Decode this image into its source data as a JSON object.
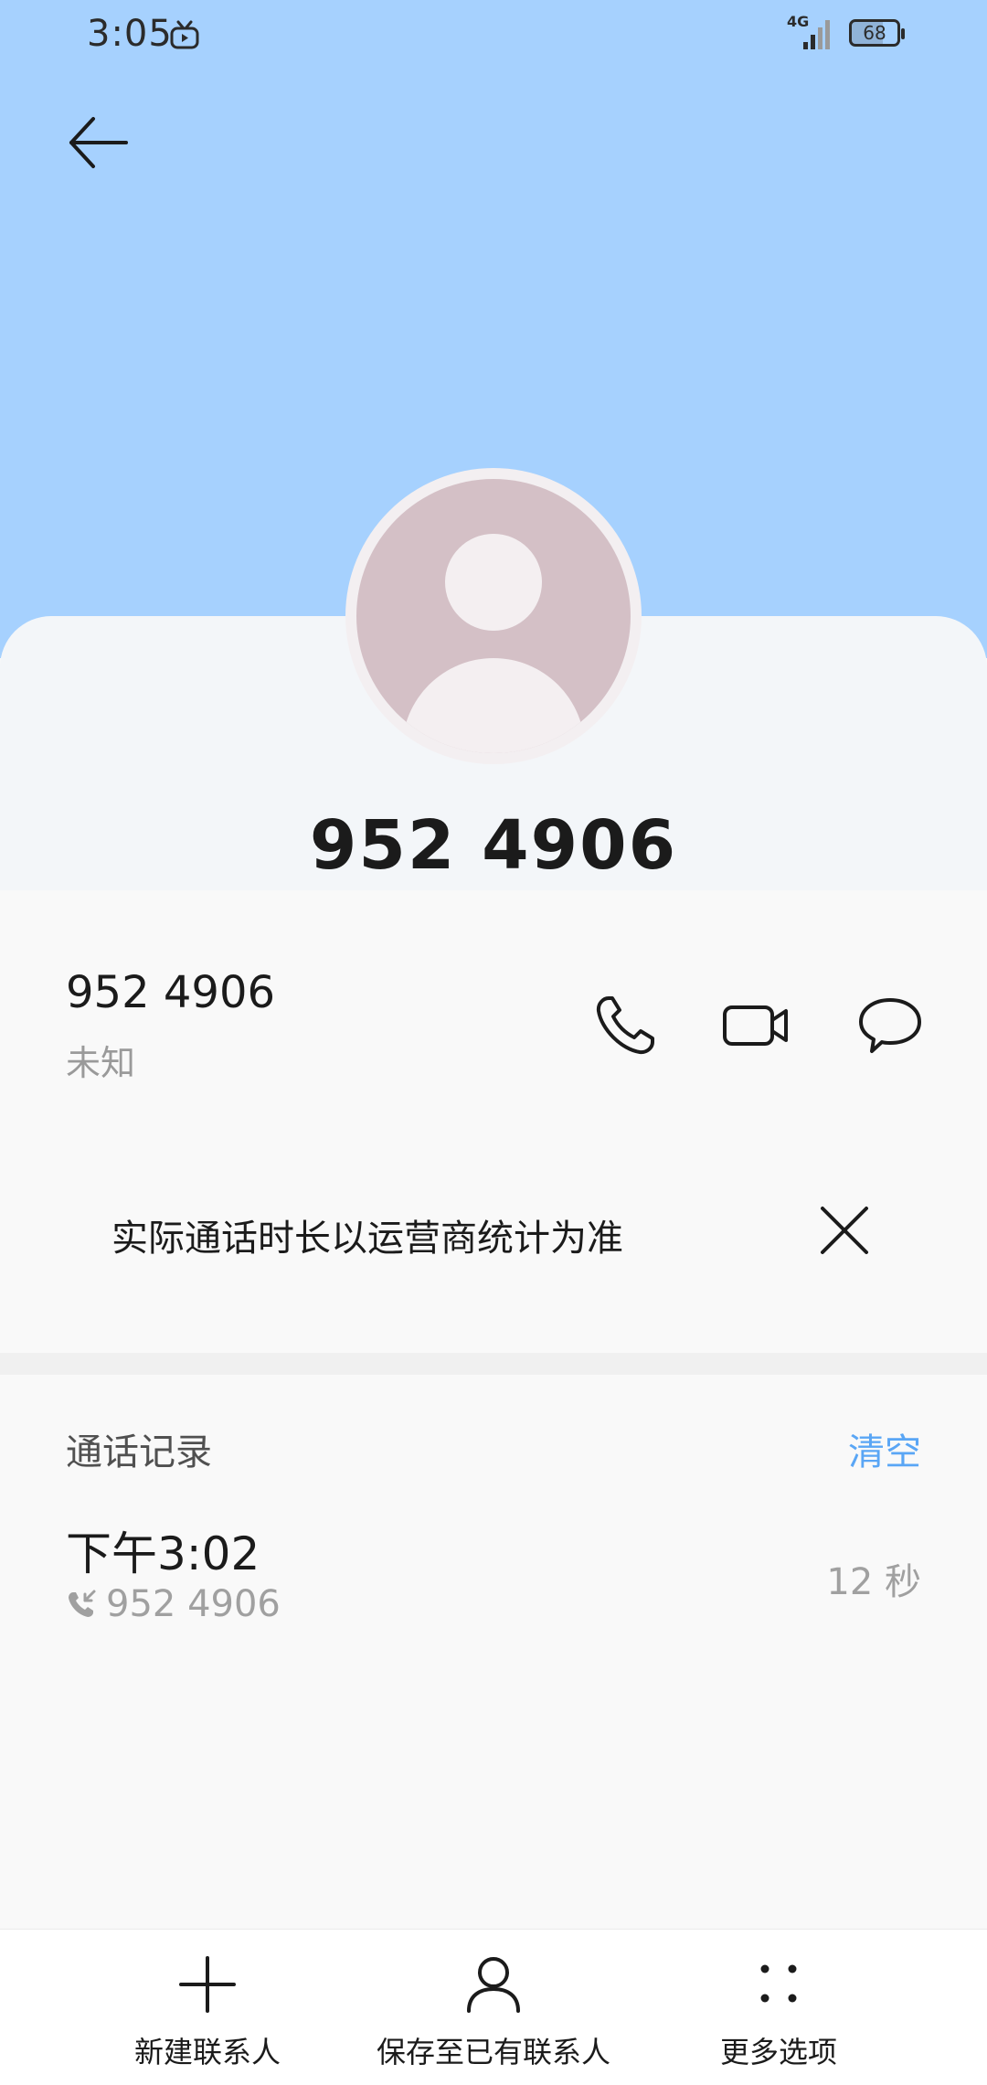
{
  "status_bar": {
    "time": "3:05",
    "network_type": "4G",
    "battery_level": "68",
    "icons": [
      "tv-icon",
      "signal-icon",
      "battery-icon"
    ]
  },
  "header": {
    "back_icon": "back-arrow-icon",
    "title": "952 4906"
  },
  "avatar": {
    "icon": "default-avatar-icon"
  },
  "number_row": {
    "number": "952 4906",
    "label": "未知",
    "actions": [
      {
        "name": "call",
        "icon": "phone-icon"
      },
      {
        "name": "video",
        "icon": "video-camera-icon"
      },
      {
        "name": "message",
        "icon": "message-icon"
      }
    ]
  },
  "notice": {
    "text": "实际通话时长以运营商统计为准",
    "close_icon": "close-icon"
  },
  "call_log": {
    "title": "通话记录",
    "clear_label": "清空",
    "entries": [
      {
        "time": "下午3:02",
        "number": "952 4906",
        "duration": "12 秒",
        "icon": "incoming-call-icon"
      }
    ]
  },
  "bottom_bar": {
    "items": [
      {
        "label": "新建联系人",
        "icon": "plus-icon"
      },
      {
        "label": "保存至已有联系人",
        "icon": "person-icon"
      },
      {
        "label": "更多选项",
        "icon": "more-dots-icon"
      }
    ]
  },
  "colors": {
    "header_bg": "#A6D1FE",
    "sheet_bg": "#F3F6F9",
    "page_bg": "#F9F9F9",
    "accent": "#5AA6F5",
    "avatar_bg": "#D4C0C6"
  }
}
